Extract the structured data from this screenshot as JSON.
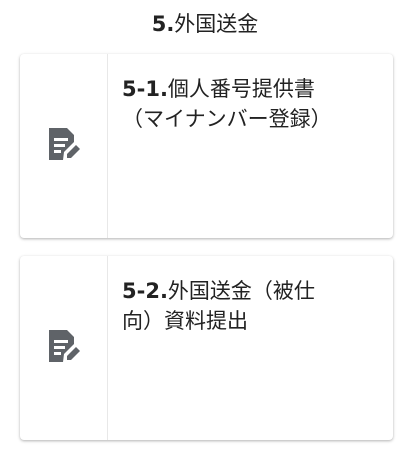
{
  "section": {
    "number": "5.",
    "title": "外国送金"
  },
  "cards": [
    {
      "number": "5-1.",
      "line1": "個人番号提供書",
      "line2": "（マイナンバー登録）",
      "icon": "document-edit-icon"
    },
    {
      "number": "5-2.",
      "line1": "外国送金（被仕",
      "line2": "向）資料提出",
      "icon": "document-edit-icon"
    }
  ],
  "colors": {
    "icon": "#5f6368",
    "text": "#222222",
    "divider": "#e8e8e8"
  }
}
